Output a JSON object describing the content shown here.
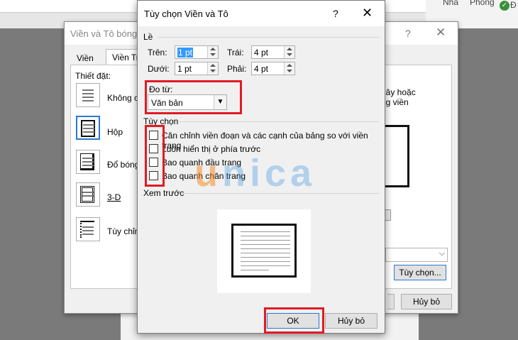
{
  "ribbon": {
    "item1": "Nhà",
    "item2": "Phòng",
    "item3": "Đ"
  },
  "back_dialog": {
    "title": "Viền và Tô bóng",
    "help": "?",
    "close": "✕",
    "tabs": [
      "Viền",
      "Viền Tr"
    ],
    "settings_label": "Thiết đặt:",
    "settings": [
      "Không c",
      "Hộp",
      "Đổ bóng",
      "3-D",
      "Tùy chỉn"
    ],
    "right_text_1": "dây hoặc",
    "right_text_2": "ng viền",
    "options_button": "Tùy chọn...",
    "cancel_button": "Hủy bỏ"
  },
  "dialog": {
    "title": "Tùy chọn Viền và Tô",
    "help": "?",
    "close": "✕",
    "margin_group": "Lề",
    "top_label": "Trên:",
    "top_value": "1 pt",
    "bottom_label": "Dưới:",
    "bottom_value": "1 pt",
    "left_label": "Trái:",
    "left_value": "4 pt",
    "right_label": "Phải:",
    "right_value": "4 pt",
    "measure_from_label": "Đo từ:",
    "measure_from_value": "Văn bản",
    "options_group": "Tùy chọn",
    "options": [
      {
        "label": "Căn chỉnh viền đoạn và các cạnh của bảng so với viền trang",
        "checked": false
      },
      {
        "label": "Luôn hiển thị ở phía trước",
        "checked": false
      },
      {
        "label": "Bao quanh đầu trang",
        "checked": false
      },
      {
        "label": "Bao quanh chân trang",
        "checked": false
      }
    ],
    "preview_group": "Xem trước",
    "ok_button": "OK",
    "cancel_button": "Hủy bỏ"
  },
  "watermark": {
    "first": "u",
    "rest": "nica"
  },
  "colors": {
    "highlight": "#e01b24",
    "accent": "#2b79d2"
  }
}
